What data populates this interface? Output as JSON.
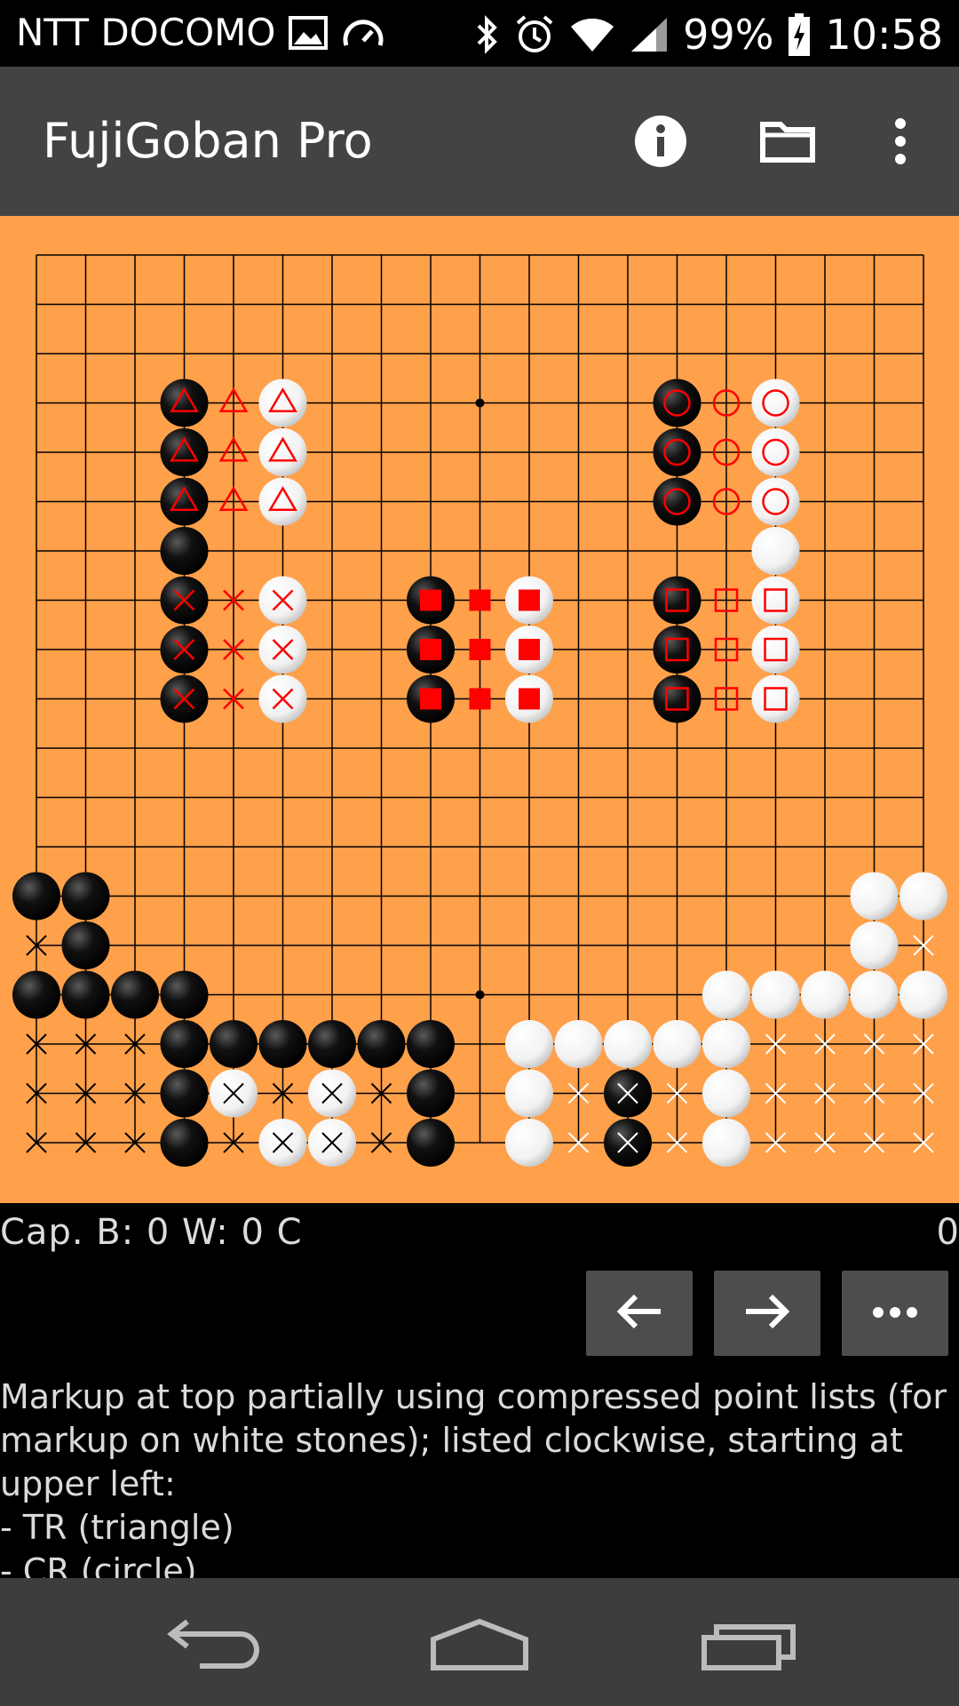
{
  "status_bar": {
    "carrier": "NTT DOCOMO",
    "battery": "99%",
    "time": "10:58",
    "left_icons": [
      "image-icon",
      "gauge-icon"
    ],
    "right_icons": [
      "bluetooth-icon",
      "alarm-icon",
      "wifi-icon",
      "signal-icon",
      "battery-charging-icon"
    ]
  },
  "action_bar": {
    "title": "FujiGoban Pro",
    "icons": [
      "info-icon",
      "folder-icon",
      "overflow-menu-icon"
    ]
  },
  "board": {
    "size": 19,
    "board_color": "#ffa04a",
    "markup_color": "#ff0000",
    "hoshi": [
      [
        9,
        3
      ],
      [
        9,
        15
      ]
    ],
    "black_stones": [
      [
        3,
        3
      ],
      [
        3,
        4
      ],
      [
        3,
        5
      ],
      [
        3,
        6
      ],
      [
        3,
        7
      ],
      [
        3,
        8
      ],
      [
        3,
        9
      ],
      [
        8,
        7
      ],
      [
        8,
        8
      ],
      [
        8,
        9
      ],
      [
        13,
        3
      ],
      [
        13,
        4
      ],
      [
        13,
        5
      ],
      [
        13,
        7
      ],
      [
        13,
        8
      ],
      [
        13,
        9
      ],
      [
        0,
        13
      ],
      [
        1,
        13
      ],
      [
        1,
        14
      ],
      [
        0,
        15
      ],
      [
        1,
        15
      ],
      [
        2,
        15
      ],
      [
        3,
        15
      ],
      [
        3,
        16
      ],
      [
        4,
        16
      ],
      [
        5,
        16
      ],
      [
        6,
        16
      ],
      [
        7,
        16
      ],
      [
        8,
        16
      ],
      [
        3,
        17
      ],
      [
        8,
        17
      ],
      [
        3,
        18
      ],
      [
        8,
        18
      ],
      [
        12,
        17
      ],
      [
        12,
        18
      ]
    ],
    "white_stones": [
      [
        5,
        3
      ],
      [
        5,
        4
      ],
      [
        5,
        5
      ],
      [
        5,
        7
      ],
      [
        5,
        8
      ],
      [
        5,
        9
      ],
      [
        10,
        7
      ],
      [
        10,
        8
      ],
      [
        10,
        9
      ],
      [
        15,
        3
      ],
      [
        15,
        4
      ],
      [
        15,
        5
      ],
      [
        15,
        6
      ],
      [
        15,
        7
      ],
      [
        15,
        8
      ],
      [
        15,
        9
      ],
      [
        17,
        13
      ],
      [
        18,
        13
      ],
      [
        17,
        14
      ],
      [
        14,
        15
      ],
      [
        15,
        15
      ],
      [
        16,
        15
      ],
      [
        17,
        15
      ],
      [
        18,
        15
      ],
      [
        10,
        16
      ],
      [
        11,
        16
      ],
      [
        12,
        16
      ],
      [
        13,
        16
      ],
      [
        14,
        16
      ],
      [
        4,
        17
      ],
      [
        6,
        17
      ],
      [
        10,
        17
      ],
      [
        14,
        17
      ],
      [
        5,
        18
      ],
      [
        6,
        18
      ],
      [
        10,
        18
      ],
      [
        14,
        18
      ]
    ],
    "markup": {
      "triangle": [
        [
          3,
          3
        ],
        [
          4,
          3
        ],
        [
          5,
          3
        ],
        [
          3,
          4
        ],
        [
          4,
          4
        ],
        [
          5,
          4
        ],
        [
          3,
          5
        ],
        [
          4,
          5
        ],
        [
          5,
          5
        ]
      ],
      "cross": [
        [
          3,
          7
        ],
        [
          4,
          7
        ],
        [
          5,
          7
        ],
        [
          3,
          8
        ],
        [
          4,
          8
        ],
        [
          5,
          8
        ],
        [
          3,
          9
        ],
        [
          4,
          9
        ],
        [
          5,
          9
        ]
      ],
      "filled_square": [
        [
          8,
          7
        ],
        [
          9,
          7
        ],
        [
          10,
          7
        ],
        [
          8,
          8
        ],
        [
          9,
          8
        ],
        [
          10,
          8
        ],
        [
          8,
          9
        ],
        [
          9,
          9
        ],
        [
          10,
          9
        ]
      ],
      "circle": [
        [
          13,
          3
        ],
        [
          14,
          3
        ],
        [
          15,
          3
        ],
        [
          13,
          4
        ],
        [
          14,
          4
        ],
        [
          15,
          4
        ],
        [
          13,
          5
        ],
        [
          14,
          5
        ],
        [
          15,
          5
        ]
      ],
      "square": [
        [
          13,
          7
        ],
        [
          14,
          7
        ],
        [
          15,
          7
        ],
        [
          13,
          8
        ],
        [
          14,
          8
        ],
        [
          15,
          8
        ],
        [
          13,
          9
        ],
        [
          14,
          9
        ],
        [
          15,
          9
        ]
      ]
    },
    "territory_marks": [
      [
        0,
        14
      ],
      [
        18,
        14
      ],
      [
        0,
        16
      ],
      [
        1,
        16
      ],
      [
        2,
        16
      ],
      [
        15,
        16
      ],
      [
        16,
        16
      ],
      [
        17,
        16
      ],
      [
        18,
        16
      ],
      [
        0,
        17
      ],
      [
        1,
        17
      ],
      [
        2,
        17
      ],
      [
        4,
        17
      ],
      [
        5,
        17
      ],
      [
        6,
        17
      ],
      [
        7,
        17
      ],
      [
        11,
        17
      ],
      [
        12,
        17
      ],
      [
        13,
        17
      ],
      [
        15,
        17
      ],
      [
        16,
        17
      ],
      [
        17,
        17
      ],
      [
        18,
        17
      ],
      [
        0,
        18
      ],
      [
        1,
        18
      ],
      [
        2,
        18
      ],
      [
        4,
        18
      ],
      [
        5,
        18
      ],
      [
        6,
        18
      ],
      [
        7,
        18
      ],
      [
        11,
        18
      ],
      [
        12,
        18
      ],
      [
        13,
        18
      ],
      [
        15,
        18
      ],
      [
        16,
        18
      ],
      [
        17,
        18
      ],
      [
        18,
        18
      ]
    ]
  },
  "captures": {
    "text": "Cap.  B: 0  W: 0  C",
    "move_number": "0"
  },
  "navigation_buttons": [
    "arrow-left-icon",
    "arrow-right-icon",
    "more-horizontal-icon"
  ],
  "comment": {
    "lines": [
      "Markup at top partially using compressed point lists (for",
      "markup on white stones); listed clockwise, starting at",
      "upper left:",
      "- TR (triangle)",
      "- CR (circle)"
    ]
  },
  "system_nav": [
    "back-icon",
    "home-icon",
    "recents-icon"
  ]
}
